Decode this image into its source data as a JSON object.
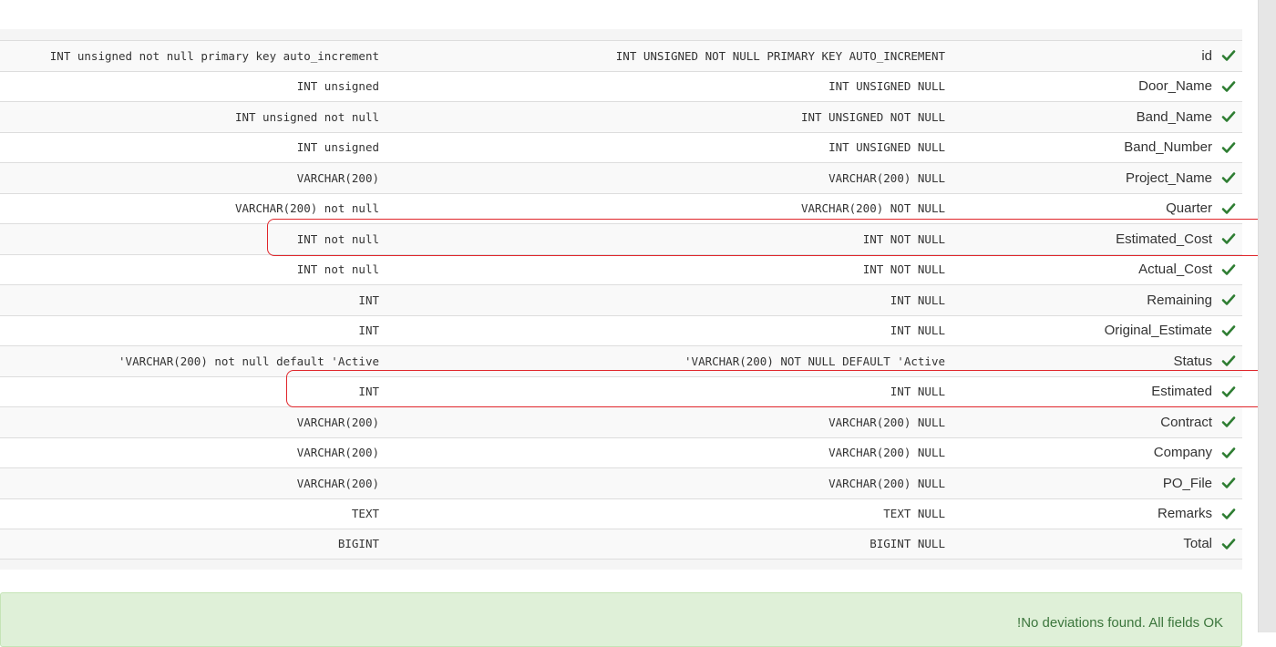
{
  "fields": [
    {
      "definition": "INT unsigned not null primary key auto_increment",
      "sql": "INT UNSIGNED NOT NULL PRIMARY KEY AUTO_INCREMENT",
      "name": "id"
    },
    {
      "definition": "INT unsigned",
      "sql": "INT UNSIGNED NULL",
      "name": "Door_Name"
    },
    {
      "definition": "INT unsigned not null",
      "sql": "INT UNSIGNED NOT NULL",
      "name": "Band_Name"
    },
    {
      "definition": "INT unsigned",
      "sql": "INT UNSIGNED NULL",
      "name": "Band_Number"
    },
    {
      "definition": "VARCHAR(200)",
      "sql": "VARCHAR(200) NULL",
      "name": "Project_Name"
    },
    {
      "definition": "VARCHAR(200) not null",
      "sql": "VARCHAR(200) NOT NULL",
      "name": "Quarter"
    },
    {
      "definition": "INT not null",
      "sql": "INT NOT NULL",
      "name": "Estimated_Cost"
    },
    {
      "definition": "INT not null",
      "sql": "INT NOT NULL",
      "name": "Actual_Cost"
    },
    {
      "definition": "INT",
      "sql": "INT NULL",
      "name": "Remaining"
    },
    {
      "definition": "INT",
      "sql": "INT NULL",
      "name": "Original_Estimate"
    },
    {
      "definition": "'VARCHAR(200) not null default 'Active",
      "sql": "'VARCHAR(200) NOT NULL DEFAULT 'Active",
      "name": "Status"
    },
    {
      "definition": "INT",
      "sql": "INT NULL",
      "name": "Estimated"
    },
    {
      "definition": "VARCHAR(200)",
      "sql": "VARCHAR(200) NULL",
      "name": "Contract"
    },
    {
      "definition": "VARCHAR(200)",
      "sql": "VARCHAR(200) NULL",
      "name": "Company"
    },
    {
      "definition": "VARCHAR(200)",
      "sql": "VARCHAR(200) NULL",
      "name": "PO_File"
    },
    {
      "definition": "TEXT",
      "sql": "TEXT NULL",
      "name": "Remarks"
    },
    {
      "definition": "BIGINT",
      "sql": "BIGINT NULL",
      "name": "Total"
    }
  ],
  "status_icon": "check-icon",
  "alert": {
    "message": "!No deviations found. All fields OK"
  },
  "colors": {
    "check": "#2e7d32",
    "highlight": "#e0262b",
    "alert_bg": "#dff0d8",
    "alert_text": "#3c763d"
  }
}
